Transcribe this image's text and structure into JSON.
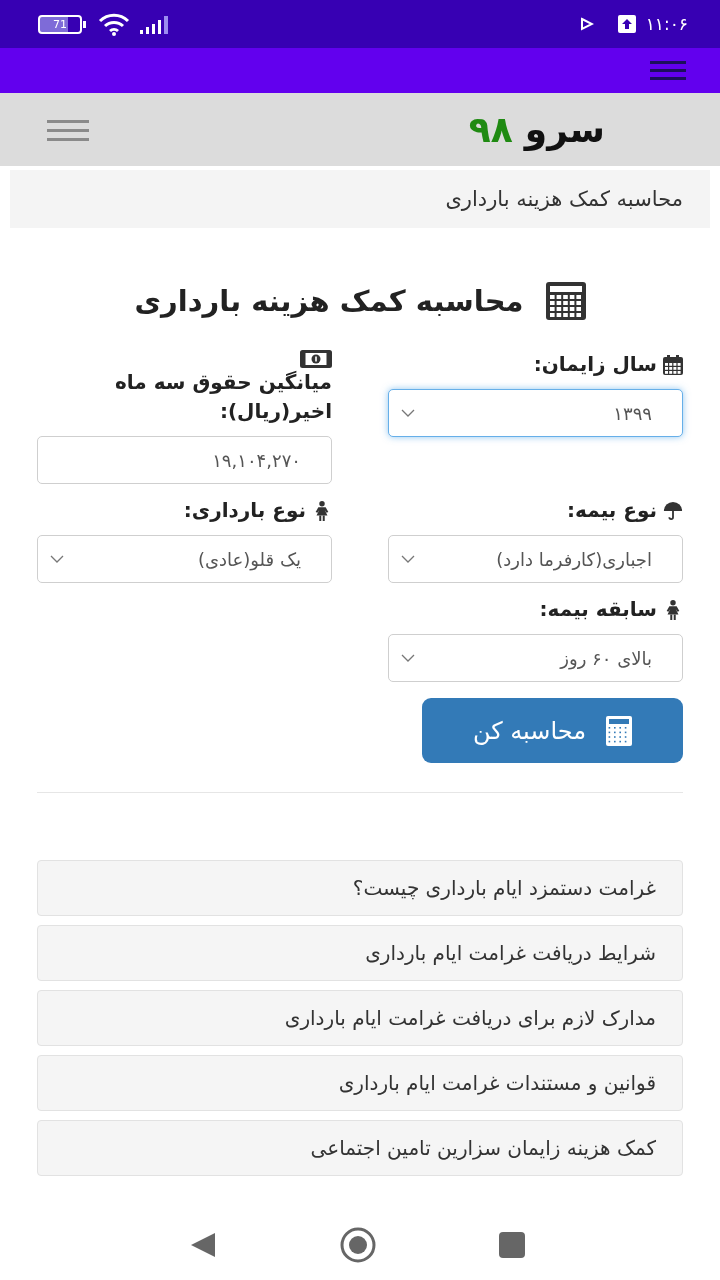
{
  "status_bar": {
    "battery": "71",
    "time": "۱۱:۰۶"
  },
  "site_header": {
    "logo": {
      "name": "سرو",
      "number": "۹۸"
    }
  },
  "breadcrumb": {
    "title": "محاسبه کمک هزینه بارداری"
  },
  "calculator": {
    "heading": "محاسبه کمک هزینه بارداری",
    "fields": [
      {
        "kind": "select",
        "label": "سال زایمان:",
        "value": "۱۳۹۹",
        "focused": true
      },
      {
        "kind": "input",
        "label": "میانگین حقوق سه ماه اخیر(ریال):",
        "value": "۱۹,۱۰۴,۲۷۰",
        "focused": false
      },
      {
        "kind": "select",
        "label": "نوع بیمه:",
        "value": "اجباری(کارفرما دارد)",
        "focused": false
      },
      {
        "kind": "select",
        "label": "نوع بارداری:",
        "value": "یک قلو(عادی)",
        "focused": false
      },
      {
        "kind": "select",
        "label": "سابقه بیمه:",
        "value": "بالای ۶۰ روز",
        "focused": false
      }
    ],
    "button": "محاسبه کن"
  },
  "faq": [
    "غرامت دستمزد ایام بارداری چیست؟",
    "شرایط دریافت غرامت ایام بارداری",
    "مدارک لازم برای دریافت غرامت ایام بارداری",
    "قوانین و مستندات غرامت ایام بارداری",
    "کمک هزینه زایمان سزارین تامین اجتماعی"
  ]
}
